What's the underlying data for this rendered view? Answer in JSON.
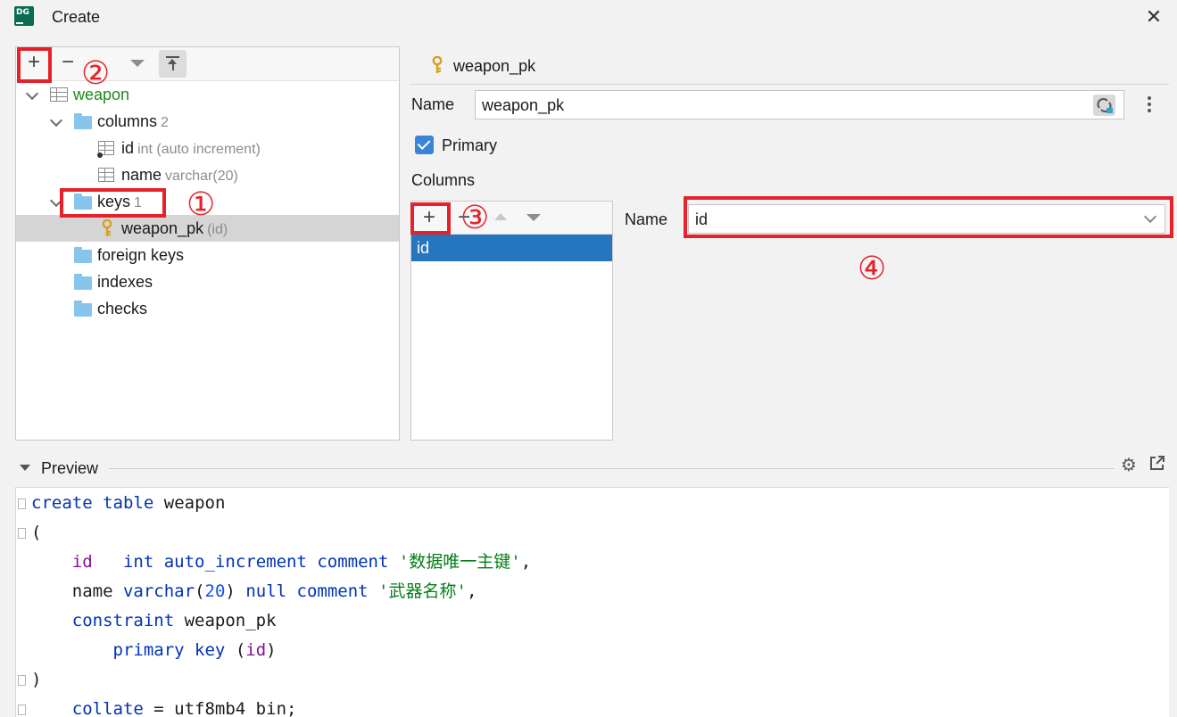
{
  "window": {
    "title": "Create",
    "app_logo": "DG",
    "close": "✕"
  },
  "tree_toolbar": {
    "add": "+",
    "remove": "−"
  },
  "tree": {
    "table": "weapon",
    "columns_label": "columns",
    "columns_count": "2",
    "col_id": "id",
    "col_id_hint": "int (auto increment)",
    "col_name": "name",
    "col_name_hint": "varchar(20)",
    "keys_label": "keys",
    "keys_count": "1",
    "key_name": "weapon_pk",
    "key_hint": "(id)",
    "foreign_keys": "foreign keys",
    "indexes": "indexes",
    "checks": "checks"
  },
  "object": {
    "header": "weapon_pk",
    "name_label": "Name",
    "name_value": "weapon_pk",
    "primary_label": "Primary",
    "primary_checked": true,
    "columns_label": "Columns"
  },
  "cols_toolbar": {
    "add": "+",
    "remove": "−"
  },
  "columns_list": [
    "id"
  ],
  "column_detail": {
    "name_label": "Name",
    "name_value": "id"
  },
  "annotations": {
    "n1": "①",
    "n2": "②",
    "n3": "③",
    "n4": "④",
    "color": "#e5222b"
  },
  "preview": {
    "label": "Preview",
    "code": {
      "l1_kw1": "create",
      "l1_kw2": "table",
      "l1_name": "weapon",
      "l2": "(",
      "l3_field": "id",
      "l3_kw": "int auto_increment comment",
      "l3_str": "'数据唯一主键'",
      "l3_end": ",",
      "l4_field": "name",
      "l4_kw1": "varchar",
      "l4_p1": "(",
      "l4_num": "20",
      "l4_p2": ")",
      "l4_kw2": "null comment",
      "l4_str": "'武器名称'",
      "l4_end": ",",
      "l5_kw": "constraint",
      "l5_name": "weapon_pk",
      "l6_kw": "primary key",
      "l6_p1": "(",
      "l6_field": "id",
      "l6_p2": ")",
      "l7": ")",
      "l8_field": "collate",
      "l8_rest": "= utf8mb4_bin;"
    }
  }
}
